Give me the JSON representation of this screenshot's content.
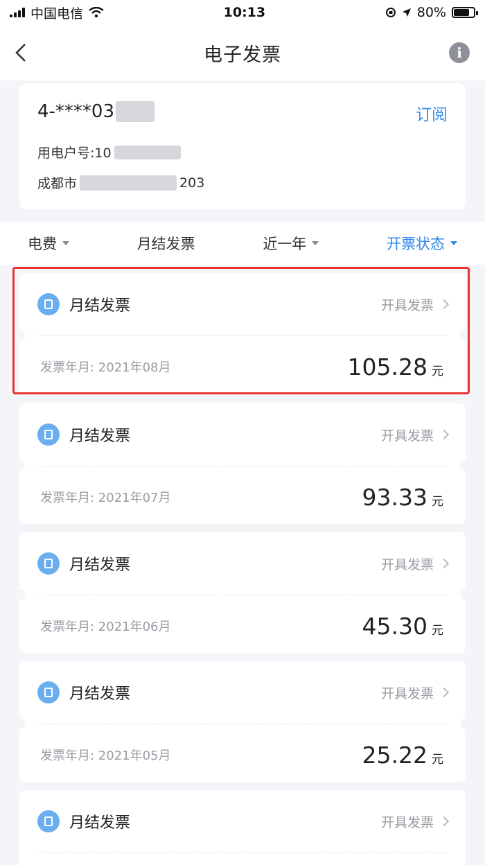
{
  "status_bar": {
    "carrier": "中国电信",
    "time": "10:13",
    "battery": "80%",
    "battery_level": 0.8
  },
  "nav": {
    "title": "电子发票"
  },
  "account": {
    "number_prefix": "4-****03",
    "subscribe_label": "订阅",
    "account_label": "用电户号:10",
    "address_prefix": "成都市",
    "address_suffix": "203"
  },
  "filters": [
    {
      "label": "电费",
      "active": false
    },
    {
      "label": "月结发票",
      "active": false
    },
    {
      "label": "近一年",
      "active": false
    },
    {
      "label": "开票状态",
      "active": true
    }
  ],
  "invoices": [
    {
      "type": "月结发票",
      "action": "开具发票",
      "date": "发票年月: 2021年08月",
      "amount": "105.28",
      "unit": "元"
    },
    {
      "type": "月结发票",
      "action": "开具发票",
      "date": "发票年月: 2021年07月",
      "amount": "93.33",
      "unit": "元"
    },
    {
      "type": "月结发票",
      "action": "开具发票",
      "date": "发票年月: 2021年06月",
      "amount": "45.30",
      "unit": "元"
    },
    {
      "type": "月结发票",
      "action": "开具发票",
      "date": "发票年月: 2021年05月",
      "amount": "25.22",
      "unit": "元"
    },
    {
      "type": "月结发票",
      "action": "开具发票"
    }
  ],
  "colors": {
    "accent": "#2f86ea",
    "highlight": "#e83131",
    "icon": "#6aaef0"
  }
}
